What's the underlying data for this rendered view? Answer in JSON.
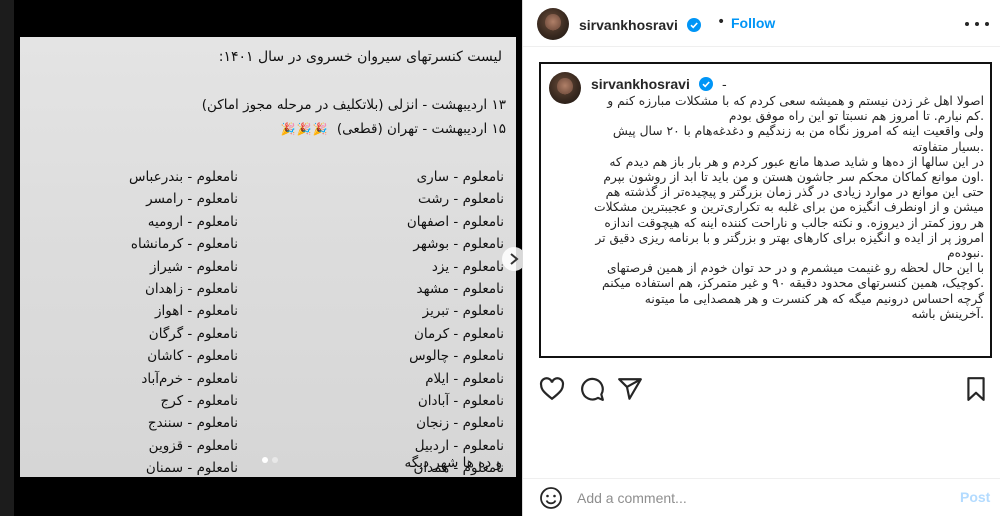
{
  "post": {
    "image": {
      "title": "لیست کنسرتهای سیروان خسروی در سال ۱۴۰۱:",
      "line1": "۱۳ اردیبهشت - انزلی (بلاتکلیف در مرحله مجوز  اماکن)",
      "line2": "۱۵ اردیبهشت - تهران (قطعی)",
      "emoji": "🎉🎉🎉",
      "col_right": [
        "نامعلوم - ساری",
        "نامعلوم - رشت",
        "نامعلوم - اصفهان",
        "نامعلوم - بوشهر",
        "نامعلوم - یزد",
        "نامعلوم - مشهد",
        "نامعلوم - تبریز",
        "نامعلوم - کرمان",
        "نامعلوم - چالوس",
        "نامعلوم - ایلام",
        "نامعلوم - آبادان",
        "نامعلوم - زنجان",
        "نامعلوم - اردبیل",
        "نامعلوم - همدان"
      ],
      "col_left": [
        "نامعلوم - بندرعباس",
        "نامعلوم - رامسر",
        "نامعلوم - ارومیه",
        "نامعلوم - کرمانشاه",
        "نامعلوم - شیراز",
        "نامعلوم - زاهدان",
        "نامعلوم - اهواز",
        "نامعلوم - گرگان",
        "نامعلوم - کاشان",
        "نامعلوم - خرم‌آباد",
        "نامعلوم - کرج",
        "نامعلوم - سنندج",
        "نامعلوم - قزوین",
        "نامعلوم - سمنان"
      ],
      "footer": "و ده ها شهر دیگه",
      "slide_count": 2,
      "active_slide": 1
    },
    "header": {
      "username": "sirvankhosravi",
      "separator": "•",
      "follow_label": "Follow",
      "verified_icon": "verified-badge-icon",
      "more_icon": "more-options-icon"
    },
    "caption": {
      "username": "sirvankhosravi",
      "dash": "-",
      "lines": [
        "اصولا اهل غر زدن نیستم و همیشه سعی کردم که با مشکلات مبارزه کنم و",
        ".کم نیارم. تا امروز هم نسبتا تو این راه موفق بودم",
        "ولی واقعیت اینه که امروز نگاه من به زندگیم و دغدغه‌هام با ۲۰ سال پیش",
        ".بسیار متفاوته",
        "در این سالها از ده‌ها و شاید صدها مانع عبور کردم و هر بار باز هم دیدم که",
        ".اون موانع کماکان محکم سر جاشون هستن و من باید تا ابد از روشون بپرم",
        "حتی این موانع در موارد زیادی در گذر زمان بزرگتر و پیچیده‌تر از گذشته هم",
        "میشن و از اونطرف انگیزه من برای غلبه به تکراری‌ترین و عجیبترین مشکلات",
        "هر روز کمتر از دیروزه. و نکته جالب و ناراحت کننده اینه که هیچوقت اندازه",
        "امروز پر از ایده و انگیزه برای کارهای بهتر و بزرگتر و با برنامه ریزی دقیق تر",
        ".نبوده‌م",
        "با این حال لحظه رو غنیمت میشمرم و در حد توان خودم از همین فرصتهای",
        ".کوچیک، همین کنسرتهای محدود دقیقه ۹۰ و غیر متمرکز، هم استفاده میکنم",
        "گرچه احساس درونیم میگه که هر کنسرت و هر همصدایی ما میتونه",
        ".آخرینش باشه"
      ]
    },
    "actions": {
      "like_icon": "heart-icon",
      "comment_icon": "comment-icon",
      "share_icon": "share-icon",
      "save_icon": "bookmark-icon"
    },
    "comment": {
      "placeholder": "Add a comment...",
      "post_label": "Post",
      "emoji_icon": "emoji-icon"
    },
    "colors": {
      "accent": "#0095f6",
      "post_disabled": "#b3dbff",
      "text": "#262626"
    }
  }
}
